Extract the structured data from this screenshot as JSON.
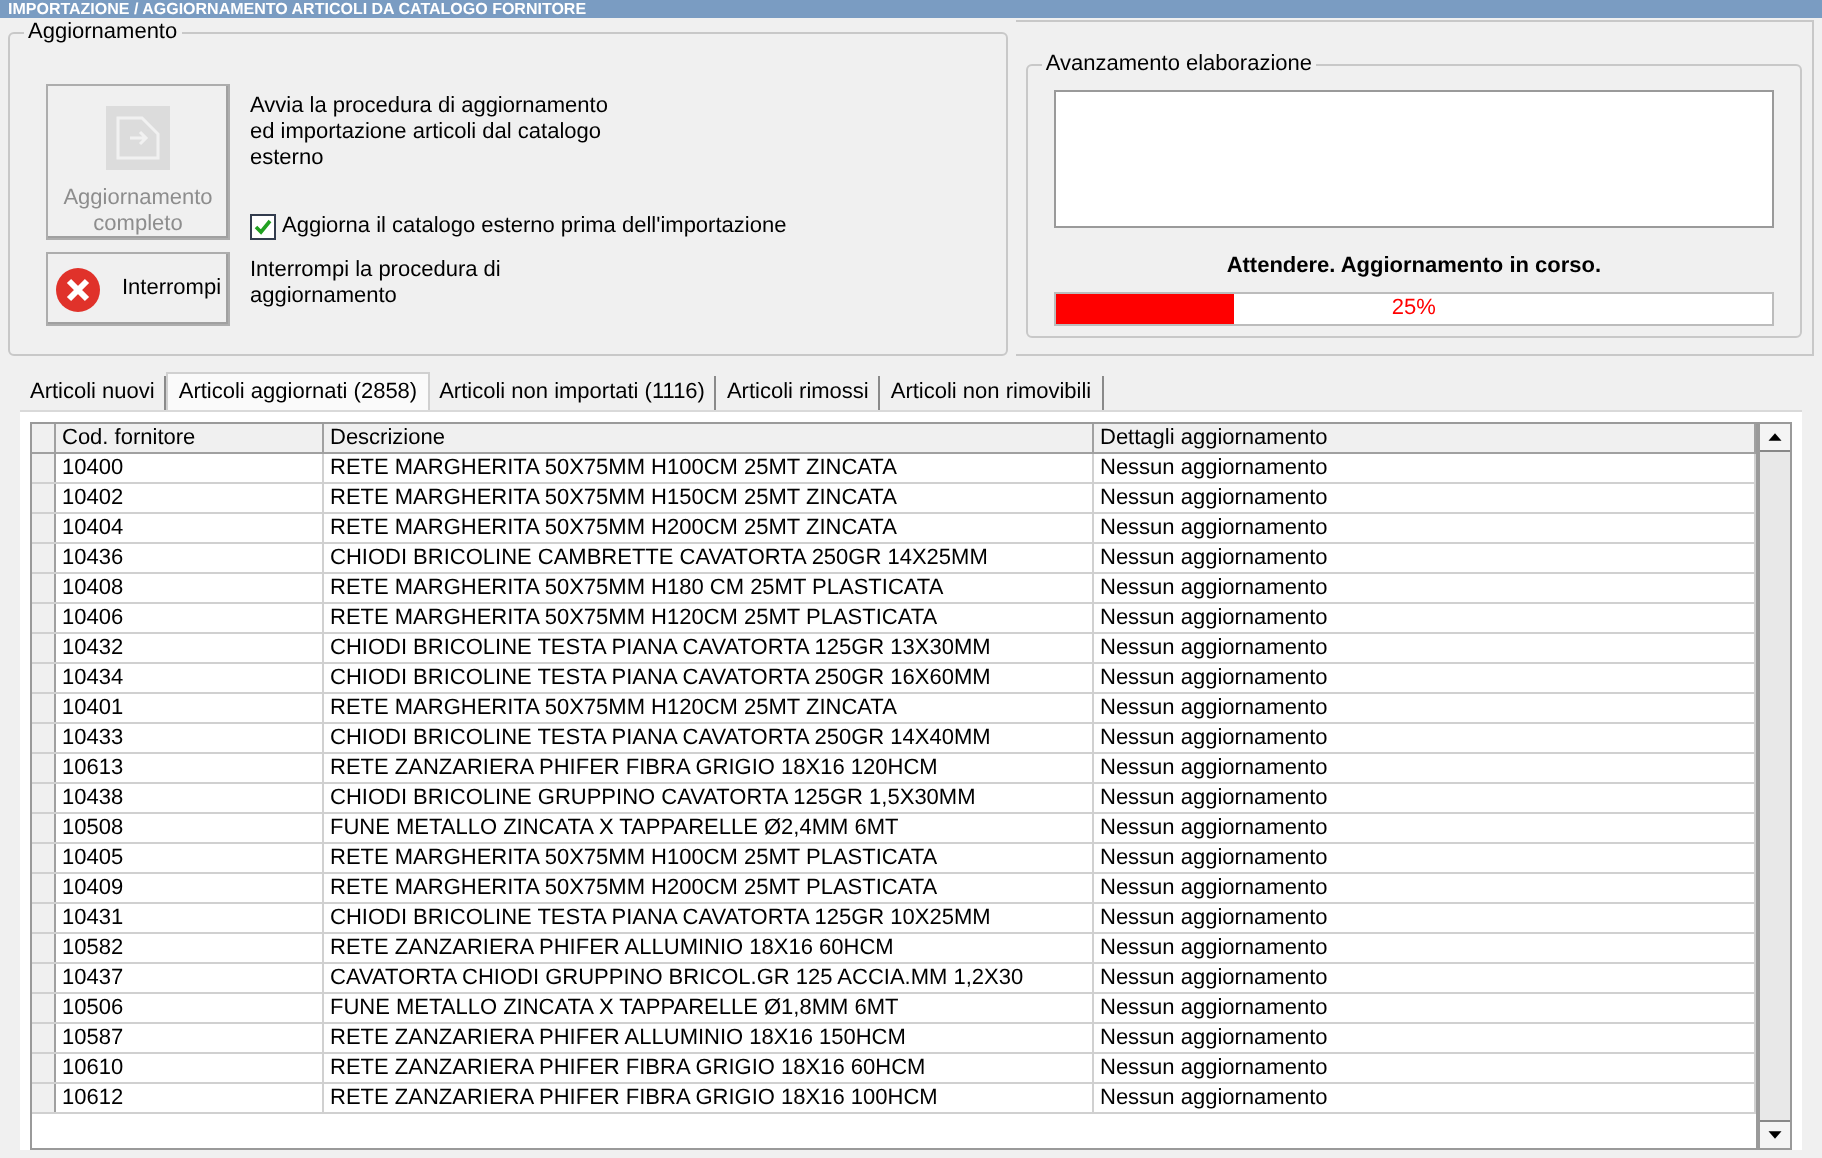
{
  "window": {
    "title": "IMPORTAZIONE / AGGIORNAMENTO ARTICOLI DA CATALOGO FORNITORE"
  },
  "update_group": {
    "title": "Aggiornamento",
    "full_update_button": {
      "label": "Aggiornamento completo",
      "disabled": true
    },
    "full_update_description": "Avvia la procedura di aggiornamento ed importazione articoli dal catalogo esterno",
    "refresh_catalog_checkbox": {
      "label": "Aggiorna il catalogo esterno prima dell'importazione",
      "checked": true
    },
    "stop_button": {
      "label": "Interrompi"
    },
    "stop_description": "Interrompi la procedura di aggiornamento"
  },
  "progress_group": {
    "title": "Avanzamento elaborazione",
    "status": "Attendere. Aggiornamento in corso.",
    "progress": {
      "level": 0.25,
      "reading": "25%"
    }
  },
  "tabs": [
    {
      "label": "Articoli nuovi",
      "selected": false
    },
    {
      "label": "Articoli aggiornati (2858)",
      "selected": true
    },
    {
      "label": "Articoli non importati (1116)",
      "selected": false
    },
    {
      "label": "Articoli rimossi",
      "selected": false
    },
    {
      "label": "Articoli non rimovibili",
      "selected": false
    }
  ],
  "table": {
    "columns": [
      "Cod. fornitore",
      "Descrizione",
      "Dettagli aggiornamento"
    ],
    "rows": [
      [
        "10400",
        "RETE MARGHERITA 50X75MM H100CM 25MT ZINCATA",
        "Nessun aggiornamento"
      ],
      [
        "10402",
        "RETE MARGHERITA 50X75MM H150CM 25MT ZINCATA",
        "Nessun aggiornamento"
      ],
      [
        "10404",
        "RETE MARGHERITA 50X75MM H200CM 25MT ZINCATA",
        "Nessun aggiornamento"
      ],
      [
        "10436",
        "CHIODI BRICOLINE CAMBRETTE CAVATORTA 250GR 14X25MM",
        "Nessun aggiornamento"
      ],
      [
        "10408",
        "RETE MARGHERITA 50X75MM H180 CM 25MT PLASTICATA",
        "Nessun aggiornamento"
      ],
      [
        "10406",
        "RETE MARGHERITA 50X75MM H120CM 25MT PLASTICATA",
        "Nessun aggiornamento"
      ],
      [
        "10432",
        "CHIODI BRICOLINE TESTA PIANA CAVATORTA 125GR 13X30MM",
        "Nessun aggiornamento"
      ],
      [
        "10434",
        "CHIODI BRICOLINE TESTA PIANA CAVATORTA 250GR 16X60MM",
        "Nessun aggiornamento"
      ],
      [
        "10401",
        "RETE MARGHERITA 50X75MM H120CM 25MT ZINCATA",
        "Nessun aggiornamento"
      ],
      [
        "10433",
        "CHIODI BRICOLINE TESTA PIANA CAVATORTA 250GR 14X40MM",
        "Nessun aggiornamento"
      ],
      [
        "10613",
        "RETE ZANZARIERA PHIFER FIBRA GRIGIO 18X16 120HCM",
        "Nessun aggiornamento"
      ],
      [
        "10438",
        "CHIODI BRICOLINE GRUPPINO CAVATORTA 125GR 1,5X30MM",
        "Nessun aggiornamento"
      ],
      [
        "10508",
        "FUNE METALLO ZINCATA X TAPPARELLE Ø2,4MM 6MT",
        "Nessun aggiornamento"
      ],
      [
        "10405",
        "RETE MARGHERITA 50X75MM H100CM 25MT PLASTICATA",
        "Nessun aggiornamento"
      ],
      [
        "10409",
        "RETE MARGHERITA 50X75MM H200CM 25MT PLASTICATA",
        "Nessun aggiornamento"
      ],
      [
        "10431",
        "CHIODI BRICOLINE TESTA PIANA CAVATORTA 125GR 10X25MM",
        "Nessun aggiornamento"
      ],
      [
        "10582",
        "RETE ZANZARIERA PHIFER ALLUMINIO 18X16 60HCM",
        "Nessun aggiornamento"
      ],
      [
        "10437",
        "CAVATORTA CHIODI GRUPPINO BRICOL.GR 125 ACCIA.MM 1,2X30",
        "Nessun aggiornamento"
      ],
      [
        "10506",
        "FUNE METALLO ZINCATA X TAPPARELLE Ø1,8MM 6MT",
        "Nessun aggiornamento"
      ],
      [
        "10587",
        "RETE ZANZARIERA PHIFER ALLUMINIO 18X16 150HCM",
        "Nessun aggiornamento"
      ],
      [
        "10610",
        "RETE ZANZARIERA PHIFER FIBRA GRIGIO 18X16 60HCM",
        "Nessun aggiornamento"
      ],
      [
        "10612",
        "RETE ZANZARIERA PHIFER FIBRA GRIGIO 18X16 100HCM",
        "Nessun aggiornamento"
      ]
    ]
  }
}
